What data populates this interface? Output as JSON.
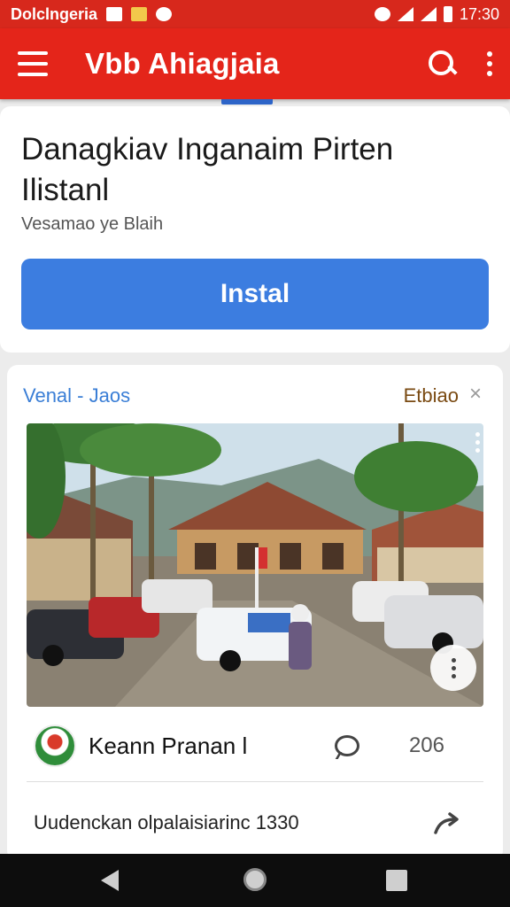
{
  "status_bar": {
    "app_name": "Dolclngeria",
    "time": "17:30"
  },
  "app_bar": {
    "title": "Vbb Ahiagjaia"
  },
  "install_card": {
    "headline": "Danagkiav Inganaim Pirten Ilistanl",
    "subtitle": "Vesamao ye Blaih",
    "button_label": "Instal"
  },
  "post": {
    "tag": "Venal - Jaos",
    "brand": "Etbiao",
    "author": "Keann Pranan l",
    "count": "206",
    "caption": "Uudenckan olpalaisiarinc 1330"
  },
  "colors": {
    "status_bar": "#d7281c",
    "app_bar": "#e4251a",
    "install_button": "#3c7de0",
    "tag": "#3a7ed6",
    "brand": "#7a4a12"
  }
}
